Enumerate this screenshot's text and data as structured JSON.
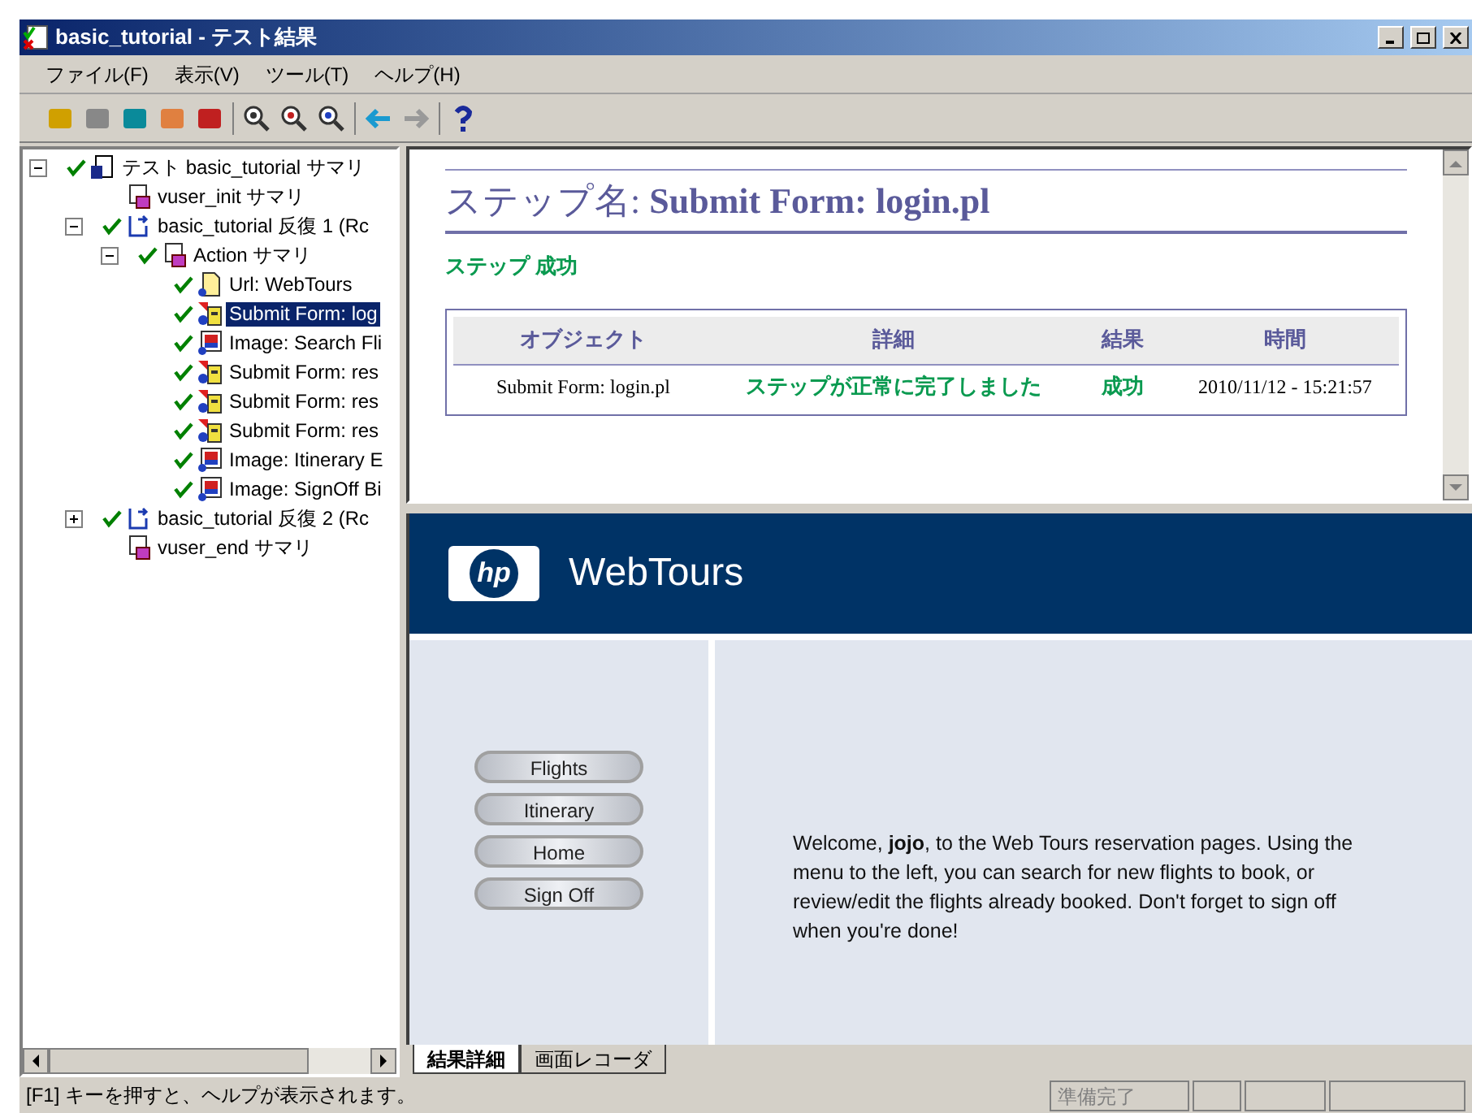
{
  "window": {
    "title": "basic_tutorial - テスト結果"
  },
  "menu": [
    "ファイル(F)",
    "表示(V)",
    "ツール(T)",
    "ヘルプ(H)"
  ],
  "tree": [
    {
      "label": "テスト basic_tutorial サマリ",
      "kind": "test",
      "passed": true,
      "selected": false,
      "expanded": true,
      "children": [
        {
          "label": "vuser_init サマリ",
          "kind": "script",
          "passed": false,
          "selected": false
        },
        {
          "label": "basic_tutorial 反復 1 (Rc",
          "kind": "iteration",
          "passed": true,
          "selected": false,
          "expanded": true,
          "children": [
            {
              "label": "Action サマリ",
              "kind": "script",
              "passed": true,
              "selected": false,
              "expanded": true,
              "children": [
                {
                  "label": "Url: WebTours",
                  "kind": "url",
                  "passed": true,
                  "selected": false
                },
                {
                  "label": "Submit Form: log",
                  "kind": "form",
                  "passed": true,
                  "selected": true
                },
                {
                  "label": "Image: Search Fli",
                  "kind": "image",
                  "passed": true,
                  "selected": false
                },
                {
                  "label": "Submit Form: res",
                  "kind": "form",
                  "passed": true,
                  "selected": false
                },
                {
                  "label": "Submit Form: res",
                  "kind": "form",
                  "passed": true,
                  "selected": false
                },
                {
                  "label": "Submit Form: res",
                  "kind": "form",
                  "passed": true,
                  "selected": false
                },
                {
                  "label": "Image: Itinerary E",
                  "kind": "image",
                  "passed": true,
                  "selected": false
                },
                {
                  "label": "Image: SignOff Bi",
                  "kind": "image",
                  "passed": true,
                  "selected": false
                }
              ]
            }
          ]
        },
        {
          "label": "basic_tutorial 反復 2 (Rc",
          "kind": "iteration",
          "passed": true,
          "selected": false,
          "expanded": false
        },
        {
          "label": "vuser_end サマリ",
          "kind": "script",
          "passed": false,
          "selected": false
        }
      ]
    }
  ],
  "report": {
    "step_title": "ステップ名: **Submit Form: login.pl**",
    "status": "ステップ 成功",
    "table": {
      "columns": [
        "オブジェクト",
        "詳細",
        "結果",
        "時間"
      ],
      "rows": [
        [
          "Submit Form: login.pl",
          "ステップが正常に完了しました",
          "成功",
          "2010/11/12 - 15:21:57"
        ]
      ]
    }
  },
  "web": {
    "logo_text": "hp",
    "brand": "WebTours",
    "nav": [
      "Flights",
      "Itinerary",
      "Home",
      "Sign Off"
    ],
    "welcome": "Welcome, **jojo**, to the Web Tours reservation pages. Using the menu to the left, you can search for new flights to book, or review/edit the flights already booked. Don't forget to sign off when you're done!"
  },
  "tabs": [
    {
      "label": "結果詳細",
      "selected": true
    },
    {
      "label": "画面レコーダ",
      "selected": false
    }
  ],
  "status_bar": {
    "hint": "[F1] キーを押すと、ヘルプが表示されます。",
    "state": "準備完了"
  }
}
